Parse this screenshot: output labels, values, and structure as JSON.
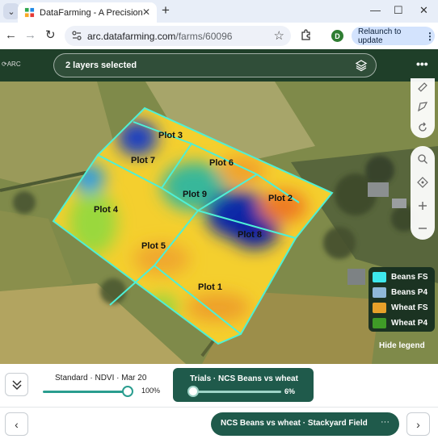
{
  "browser": {
    "tab_title": "DataFarming - A Precision Agri",
    "url_host": "arc.datafarming.com",
    "url_path": "/farms/60096",
    "profile_initial": "D",
    "relaunch_label": "Relaunch to update"
  },
  "app": {
    "logo_text": "ARC",
    "layers_label": "2 layers selected"
  },
  "map": {
    "plots": [
      "Plot 3",
      "Plot 7",
      "Plot 6",
      "Plot 9",
      "Plot 2",
      "Plot 4",
      "Plot 8",
      "Plot 5",
      "Plot 1"
    ]
  },
  "legend": {
    "items": [
      {
        "label": "Beans FS",
        "color": "#3ee8ec"
      },
      {
        "label": "Beans P4",
        "color": "#8fb8d8"
      },
      {
        "label": "Wheat FS",
        "color": "#e8a12a"
      },
      {
        "label": "Wheat P4",
        "color": "#3f9b27"
      }
    ],
    "hide_label": "Hide legend"
  },
  "bottom": {
    "standard_label": "Standard · NDVI · Mar 20",
    "standard_opacity": "100%",
    "trials_label": "Trials · NCS Beans vs wheat",
    "trials_opacity": "6%",
    "trial_name": "NCS Beans vs wheat · Stackyard Field"
  }
}
